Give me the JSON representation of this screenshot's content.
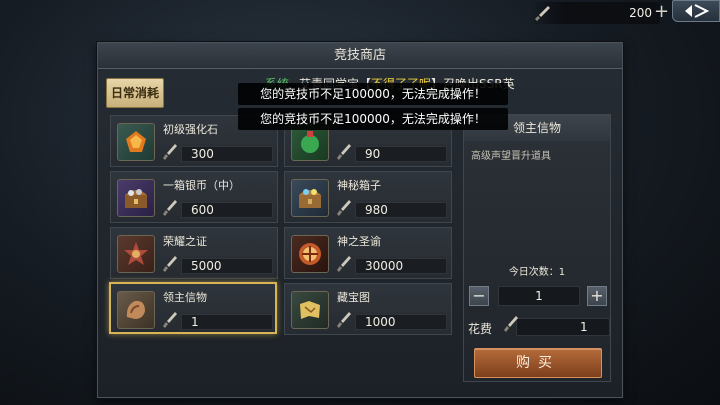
{
  "currency": {
    "amount": "200",
    "plus": "+"
  },
  "shop": {
    "title": "竞技商店",
    "tab": "日常消耗",
    "marquee": {
      "sys": "系统",
      "text": "艾青同学宝【",
      "highlight": "不得了了呢",
      "text2": "】召唤出SSR英"
    },
    "items": [
      {
        "name": "初级强化石",
        "price": "300"
      },
      {
        "name": "",
        "price": "90"
      },
      {
        "name": "一箱银币（中）",
        "price": "600"
      },
      {
        "name": "神秘箱子",
        "price": "980"
      },
      {
        "name": "荣耀之证",
        "price": "5000"
      },
      {
        "name": "神之圣谕",
        "price": "30000"
      },
      {
        "name": "领主信物",
        "price": "1"
      },
      {
        "name": "藏宝图",
        "price": "1000"
      }
    ]
  },
  "detail": {
    "title": "领主信物",
    "desc": "高级声望晋升道具",
    "daily": "今日次数：1",
    "minus": "−",
    "plus": "+",
    "quantity": "1",
    "cost_label": "花费",
    "cost": "1",
    "buy": "购买"
  },
  "toasts": [
    "您的竞技币不足100000，无法完成操作！",
    "您的竞技币不足100000，无法完成操作！"
  ],
  "colors": {
    "accent_gold": "#d7b557",
    "buy_button": "#b56b3a",
    "system_green": "#59c26a",
    "highlight_yellow": "#f0d040"
  }
}
